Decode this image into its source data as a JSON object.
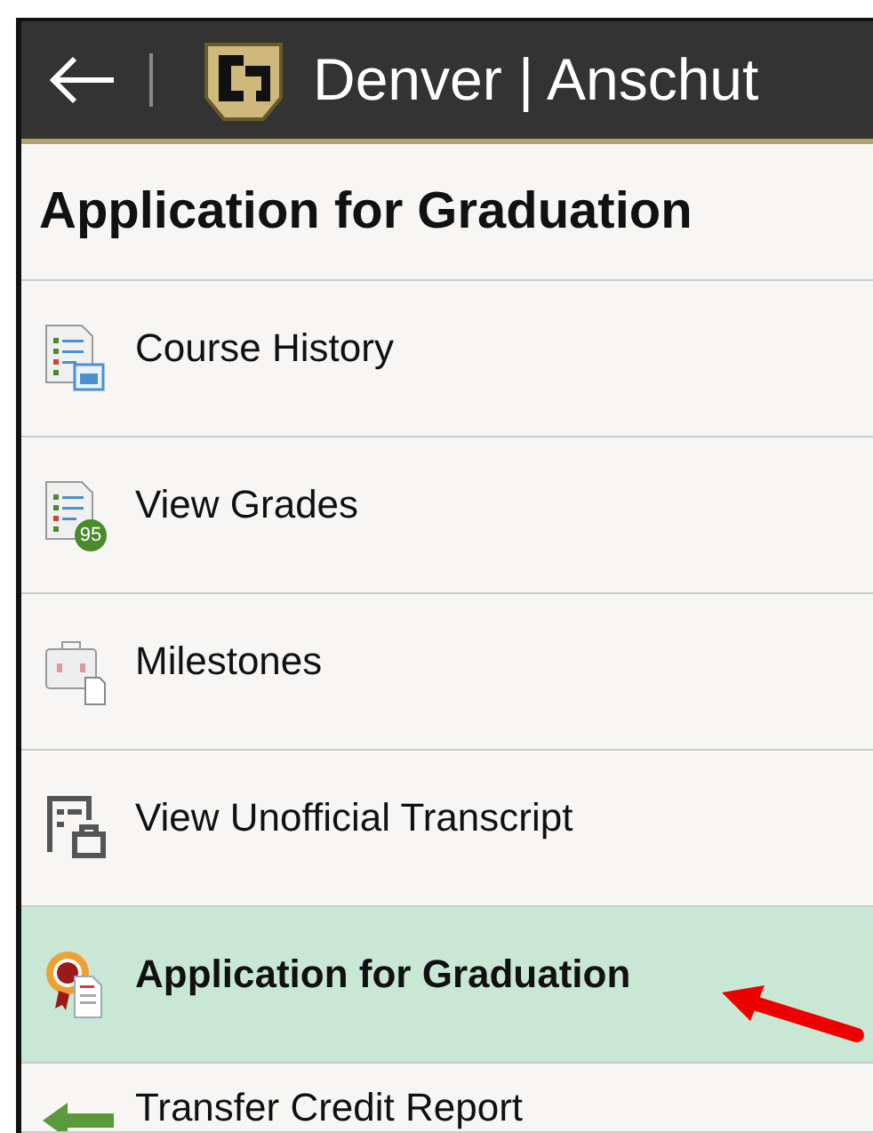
{
  "header": {
    "brand": "Denver | Anschut"
  },
  "page_title": "Application for Graduation",
  "items": [
    {
      "label": "Course History",
      "selected": false
    },
    {
      "label": "View Grades",
      "selected": false,
      "icon_badge": "95"
    },
    {
      "label": "Milestones",
      "selected": false
    },
    {
      "label": "View Unofficial Transcript",
      "selected": false
    },
    {
      "label": "Application for Graduation",
      "selected": true
    },
    {
      "label": "Transfer Credit Report",
      "selected": false
    }
  ]
}
